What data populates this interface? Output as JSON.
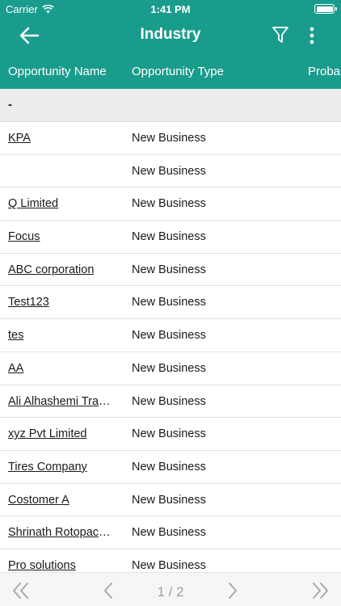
{
  "status_bar": {
    "carrier": "Carrier",
    "time": "1:41 PM"
  },
  "nav": {
    "title": "Industry"
  },
  "columns": [
    "Opportunity Name",
    "Opportunity Type",
    "Probab"
  ],
  "group": {
    "label": "-"
  },
  "rows": [
    {
      "name": "KPA",
      "type": "New Business"
    },
    {
      "name": "",
      "type": "New Business"
    },
    {
      "name": "Q Limited",
      "type": "New Business"
    },
    {
      "name": "Focus",
      "type": "New Business"
    },
    {
      "name": "ABC corporation",
      "type": "New Business"
    },
    {
      "name": "Test123",
      "type": "New Business"
    },
    {
      "name": "tes",
      "type": "New Business"
    },
    {
      "name": "AA",
      "type": "New Business"
    },
    {
      "name": "Ali Alhashemi Trading",
      "type": "New Business"
    },
    {
      "name": "xyz Pvt Limited",
      "type": "New Business"
    },
    {
      "name": "Tires Company",
      "type": "New Business"
    },
    {
      "name": "Costomer A",
      "type": "New Business"
    },
    {
      "name": "Shrinath Rotopack Pvt Ltd",
      "type": "New Business"
    },
    {
      "name": "Pro solutions",
      "type": "New Business"
    }
  ],
  "pager": {
    "label": "1 / 2"
  },
  "colors": {
    "header": "#1a9c8c",
    "pager_icon": "#a8a8a8"
  },
  "icons": {
    "back": "arrow-left-icon",
    "filter": "funnel-icon",
    "more": "vertical-dots-icon",
    "first": "double-chevron-left-icon",
    "prev": "chevron-left-icon",
    "next": "chevron-right-icon",
    "last": "double-chevron-right-icon"
  }
}
